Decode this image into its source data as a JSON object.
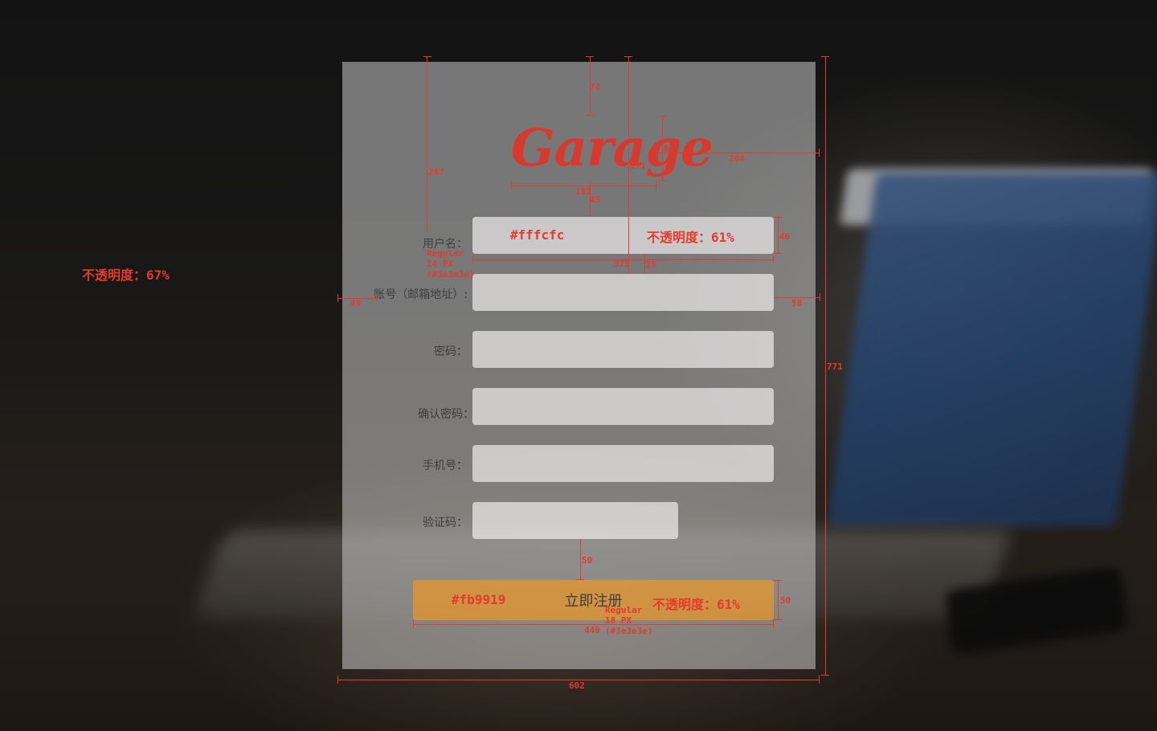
{
  "brand": {
    "logo_text": "Garage",
    "logo_color": "#d8392e"
  },
  "form": {
    "username_label": "用户名：",
    "account_label": "账号（邮箱地址）:",
    "password_label": "密码：",
    "confirm_label": "确认密码：",
    "phone_label": "手机号：",
    "captcha_label": "验证码：",
    "submit_label": "立即注册"
  },
  "colors": {
    "field_bg": "#fffcfc",
    "button_bg": "#fb9919",
    "text": "#3e3e3e",
    "annotation": "#e33b2e"
  },
  "annotations": {
    "page_opacity": "不透明度：67%",
    "field_color": "#fffcfc",
    "field_opacity": "不透明度：61%",
    "button_color": "#fb9919",
    "button_opacity": "不透明度：61%",
    "label_font_1": "Regular",
    "label_font_2": "14 PX",
    "label_font_3": "(#3e3e3e)",
    "button_font_1": "Regular",
    "button_font_2": "18 PX",
    "button_font_3": "(#3e3e3e)",
    "d74": "74",
    "d287": "287",
    "d81": "81",
    "d204": "204",
    "d271": "271",
    "d181": "181",
    "d45": "45",
    "d46": "46",
    "d375": "375",
    "d25": "25",
    "d49": "49",
    "d58": "58",
    "d771": "771",
    "d50a": "50",
    "d50b": "50",
    "d449": "449",
    "d602": "602"
  }
}
